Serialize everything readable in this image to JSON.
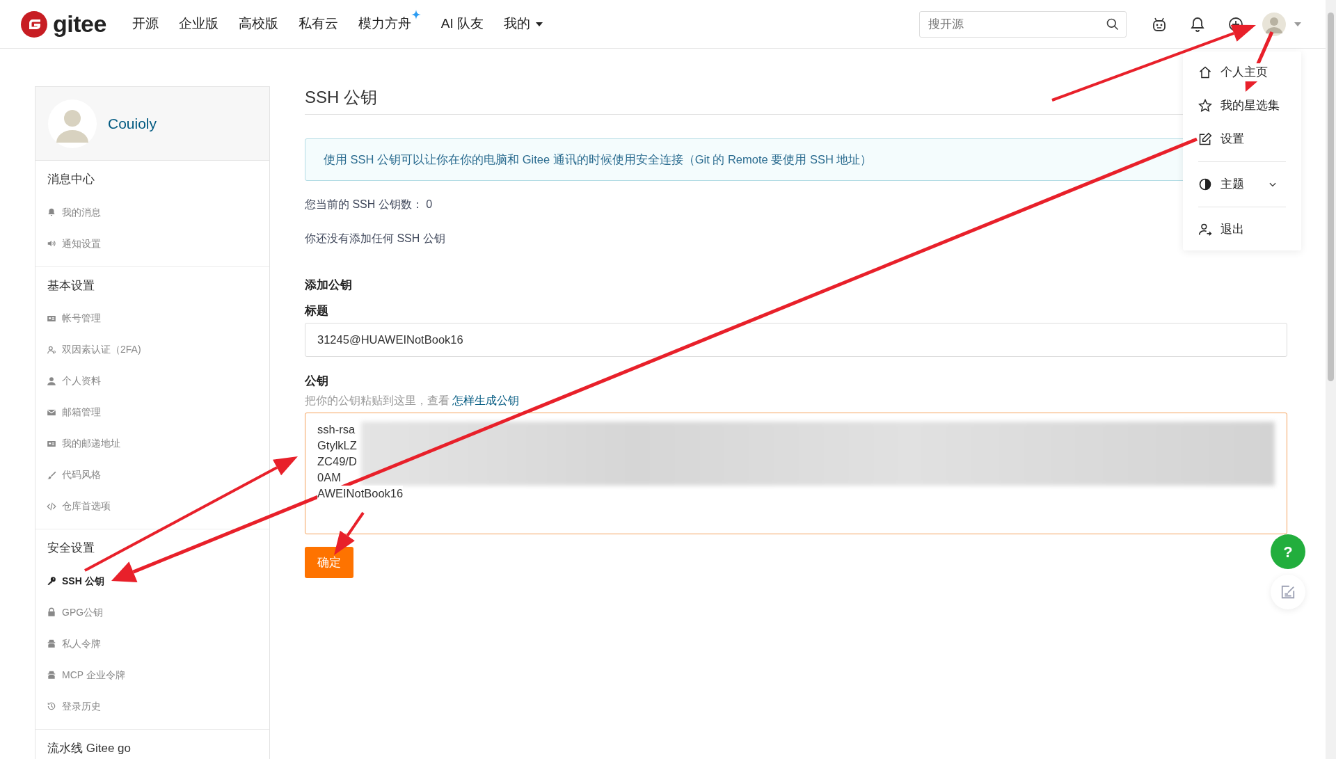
{
  "header": {
    "logo": "gitee",
    "nav": [
      {
        "label": "开源",
        "kind": "link"
      },
      {
        "label": "企业版",
        "kind": "link"
      },
      {
        "label": "高校版",
        "kind": "link"
      },
      {
        "label": "私有云",
        "kind": "link"
      },
      {
        "label": "模力方舟",
        "kind": "sparkle"
      },
      {
        "label": "AI 队友",
        "kind": "link"
      },
      {
        "label": "我的",
        "kind": "dropdown"
      }
    ],
    "search": {
      "placeholder": "搜开源"
    }
  },
  "user_menu": [
    {
      "label": "个人主页",
      "kind": "link"
    },
    {
      "label": "我的星选集",
      "kind": "link"
    },
    {
      "label": "设置",
      "kind": "link"
    },
    {
      "label": "主题",
      "kind": "expand"
    },
    {
      "label": "退出",
      "kind": "link"
    }
  ],
  "sidebar": {
    "user": "Couioly",
    "sections": [
      {
        "title": "消息中心",
        "items": [
          {
            "label": "我的消息",
            "selected": false
          },
          {
            "label": "通知设置",
            "selected": false
          }
        ]
      },
      {
        "title": "基本设置",
        "items": [
          {
            "label": "帐号管理",
            "selected": false
          },
          {
            "label": "双因素认证（2FA)",
            "selected": false
          },
          {
            "label": "个人资料",
            "selected": false
          },
          {
            "label": "邮箱管理",
            "selected": false
          },
          {
            "label": "我的邮递地址",
            "selected": false
          },
          {
            "label": "代码风格",
            "selected": false
          },
          {
            "label": "仓库首选项",
            "selected": false
          }
        ]
      },
      {
        "title": "安全设置",
        "items": [
          {
            "label": "SSH 公钥",
            "selected": true
          },
          {
            "label": "GPG公钥",
            "selected": false
          },
          {
            "label": "私人令牌",
            "selected": false
          },
          {
            "label": "MCP 企业令牌",
            "selected": false
          },
          {
            "label": "登录历史",
            "selected": false
          }
        ]
      },
      {
        "title": "流水线 Gitee go"
      }
    ]
  },
  "main": {
    "title": "SSH 公钥",
    "alert": "使用 SSH 公钥可以让你在你的电脑和 Gitee 通讯的时候使用安全连接（Git 的 Remote 要使用 SSH 地址）",
    "count": "您当前的 SSH 公钥数： 0",
    "empty": "你还没有添加任何 SSH 公钥",
    "form_title": "添加公钥",
    "title_label": "标题",
    "title_value": "31245@HUAWEINotBook16",
    "key_label": "公钥",
    "key_hint": "把你的公钥粘贴到这里，查看 ",
    "key_hint_link": "怎样生成公钥",
    "key_lines": [
      "ssh-rsa",
      "GtylkLZ",
      "ZC49/D",
      "0AM",
      "AWEINotBook16"
    ],
    "submit": "确定",
    "help": "?"
  }
}
